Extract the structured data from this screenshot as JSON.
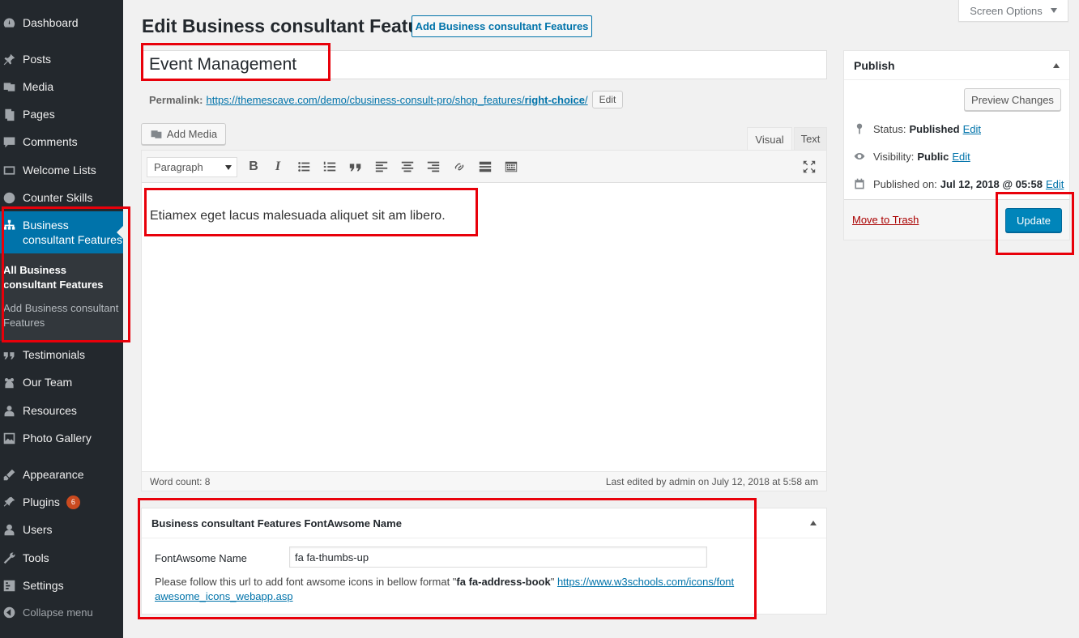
{
  "sidebar": {
    "items": [
      {
        "label": "Dashboard",
        "icon": "dashboard-icon"
      },
      {
        "label": "Posts",
        "icon": "pin-icon"
      },
      {
        "label": "Media",
        "icon": "media-icon"
      },
      {
        "label": "Pages",
        "icon": "pages-icon"
      },
      {
        "label": "Comments",
        "icon": "comment-icon"
      },
      {
        "label": "Welcome Lists",
        "icon": "welcome-icon"
      },
      {
        "label": "Counter Skills",
        "icon": "counter-icon"
      },
      {
        "label": "Business consultant Features",
        "icon": "sitemap-icon"
      },
      {
        "label": "Testimonials",
        "icon": "quote-icon"
      },
      {
        "label": "Our Team",
        "icon": "team-icon"
      },
      {
        "label": "Resources",
        "icon": "resources-icon"
      },
      {
        "label": "Photo Gallery",
        "icon": "gallery-icon"
      },
      {
        "label": "Appearance",
        "icon": "brush-icon"
      },
      {
        "label": "Plugins",
        "icon": "plugin-icon",
        "badge": "6"
      },
      {
        "label": "Users",
        "icon": "user-icon"
      },
      {
        "label": "Tools",
        "icon": "wrench-icon"
      },
      {
        "label": "Settings",
        "icon": "settings-icon"
      }
    ],
    "submenu": {
      "all": "All Business consultant Features",
      "add": "Add Business consultant Features"
    },
    "collapse": "Collapse menu"
  },
  "header": {
    "title": "Edit Business consultant Feature",
    "add_new": "Add Business consultant Features",
    "screen_options": "Screen Options"
  },
  "post": {
    "title": "Event Management",
    "permalink_label": "Permalink:",
    "permalink_base": "https://themescave.com/demo/cbusiness-consult-pro/shop_features/",
    "permalink_slug": "right-choice",
    "permalink_end": "/",
    "edit_label": "Edit"
  },
  "editor": {
    "add_media": "Add Media",
    "tab_visual": "Visual",
    "tab_text": "Text",
    "format": "Paragraph",
    "content": "Etiamex eget lacus malesuada aliquet sit am libero.",
    "word_count": "Word count: 8",
    "last_edited": "Last edited by admin on July 12, 2018 at 5:58 am"
  },
  "metabox": {
    "title": "Business consultant Features FontAwsome Name",
    "field_label": "FontAwsome Name",
    "field_value": "fa fa-thumbs-up",
    "help_prefix": "Please follow this url to add font awsome icons in bellow format \"",
    "help_bold": "fa fa-address-book",
    "help_suffix": "\" ",
    "help_link": "https://www.w3schools.com/icons/fontawesome_icons_webapp.asp"
  },
  "publish": {
    "title": "Publish",
    "preview": "Preview Changes",
    "status_label": "Status:",
    "status_value": "Published",
    "visibility_label": "Visibility:",
    "visibility_value": "Public",
    "published_label": "Published on:",
    "published_value": "Jul 12, 2018 @ 05:58",
    "edit": "Edit",
    "trash": "Move to Trash",
    "update": "Update"
  },
  "colors": {
    "sidebar_bg": "#23282d",
    "accent": "#0073aa",
    "update_btn": "#0085ba",
    "highlight": "#e8000a"
  }
}
